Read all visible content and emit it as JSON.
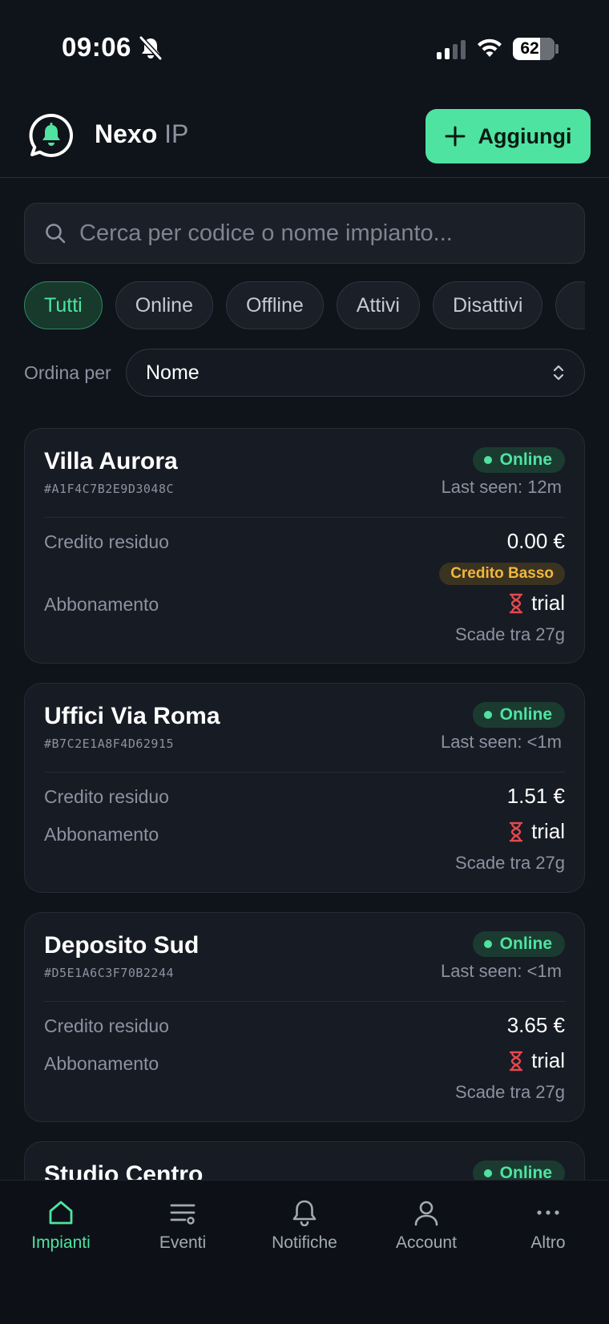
{
  "status_bar": {
    "time": "09:06",
    "battery": "62"
  },
  "header": {
    "brand": "Nexo",
    "brand_suffix": "IP",
    "add_label": "Aggiungi"
  },
  "search": {
    "placeholder": "Cerca per codice o nome impianto..."
  },
  "filters": [
    "Tutti",
    "Online",
    "Offline",
    "Attivi",
    "Disattivi",
    ""
  ],
  "sort": {
    "label": "Ordina per",
    "value": "Nome"
  },
  "cards": [
    {
      "name": "Villa Aurora",
      "code": "#A1F4C7B2E9D3048C",
      "status": "Online",
      "last_seen": "Last seen: 12m",
      "credit_label": "Credito residuo",
      "credit": "0.00 €",
      "low_badge": "Credito Basso",
      "sub_label": "Abbonamento",
      "plan": "trial",
      "expires": "Scade tra 27g"
    },
    {
      "name": "Uffici Via Roma",
      "code": "#B7C2E1A8F4D62915",
      "status": "Online",
      "last_seen": "Last seen: <1m",
      "credit_label": "Credito residuo",
      "credit": "1.51 €",
      "sub_label": "Abbonamento",
      "plan": "trial",
      "expires": "Scade tra 27g"
    },
    {
      "name": "Deposito Sud",
      "code": "#D5E1A6C3F70B2244",
      "status": "Online",
      "last_seen": "Last seen: <1m",
      "credit_label": "Credito residuo",
      "credit": "3.65 €",
      "sub_label": "Abbonamento",
      "plan": "trial",
      "expires": "Scade tra 27g"
    },
    {
      "name": "Studio Centro",
      "status": "Online"
    }
  ],
  "nav": [
    {
      "label": "Impianti",
      "icon": "home-icon",
      "active": true
    },
    {
      "label": "Eventi",
      "icon": "list-icon"
    },
    {
      "label": "Notifiche",
      "icon": "bell-icon"
    },
    {
      "label": "Account",
      "icon": "user-icon"
    },
    {
      "label": "Altro",
      "icon": "more-icon"
    }
  ],
  "colors": {
    "accent": "#4fe3a1",
    "background": "#0f131a",
    "card": "#161b24",
    "warning": "#f2b63c",
    "hourglass": "#e5484d"
  }
}
